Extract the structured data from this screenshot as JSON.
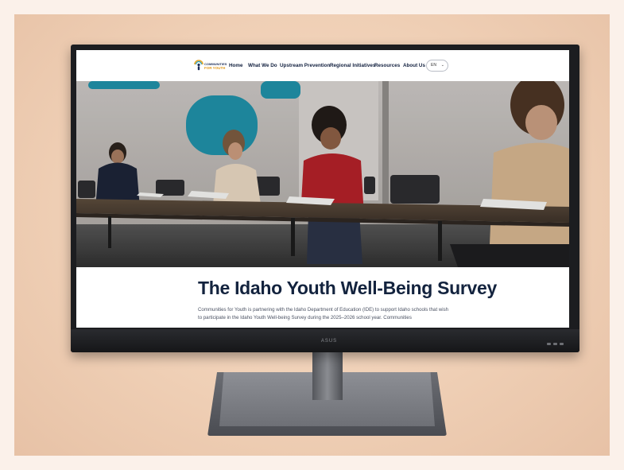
{
  "nav": {
    "logo_line1": "COMMUNITIES",
    "logo_line2": "FOR YOUTH",
    "items": [
      {
        "label": "Home"
      },
      {
        "label": "What We Do"
      },
      {
        "label": "Upstream Prevention"
      },
      {
        "label": "Regional Initiatives"
      },
      {
        "label": "Resources"
      },
      {
        "label": "About Us"
      }
    ],
    "language": "EN",
    "language_chevron": "⌄"
  },
  "hero": {
    "image_description": "students-taking-survey-at-tables"
  },
  "main": {
    "title": "The Idaho Youth Well-Being Survey",
    "intro": "Communities for Youth is partnering with the Idaho Department of Education (IDE) to support Idaho schools that wish to participate in the Idaho Youth Well-being Survey during the 2025–2026 school year. Communities"
  },
  "monitor": {
    "brand": "ASUS"
  },
  "colors": {
    "nav_text": "#12203f",
    "title": "#13233e",
    "logo_blue": "#1d2f5a",
    "logo_orange": "#e29a1e",
    "panel_teal": "#1e8fa6"
  }
}
